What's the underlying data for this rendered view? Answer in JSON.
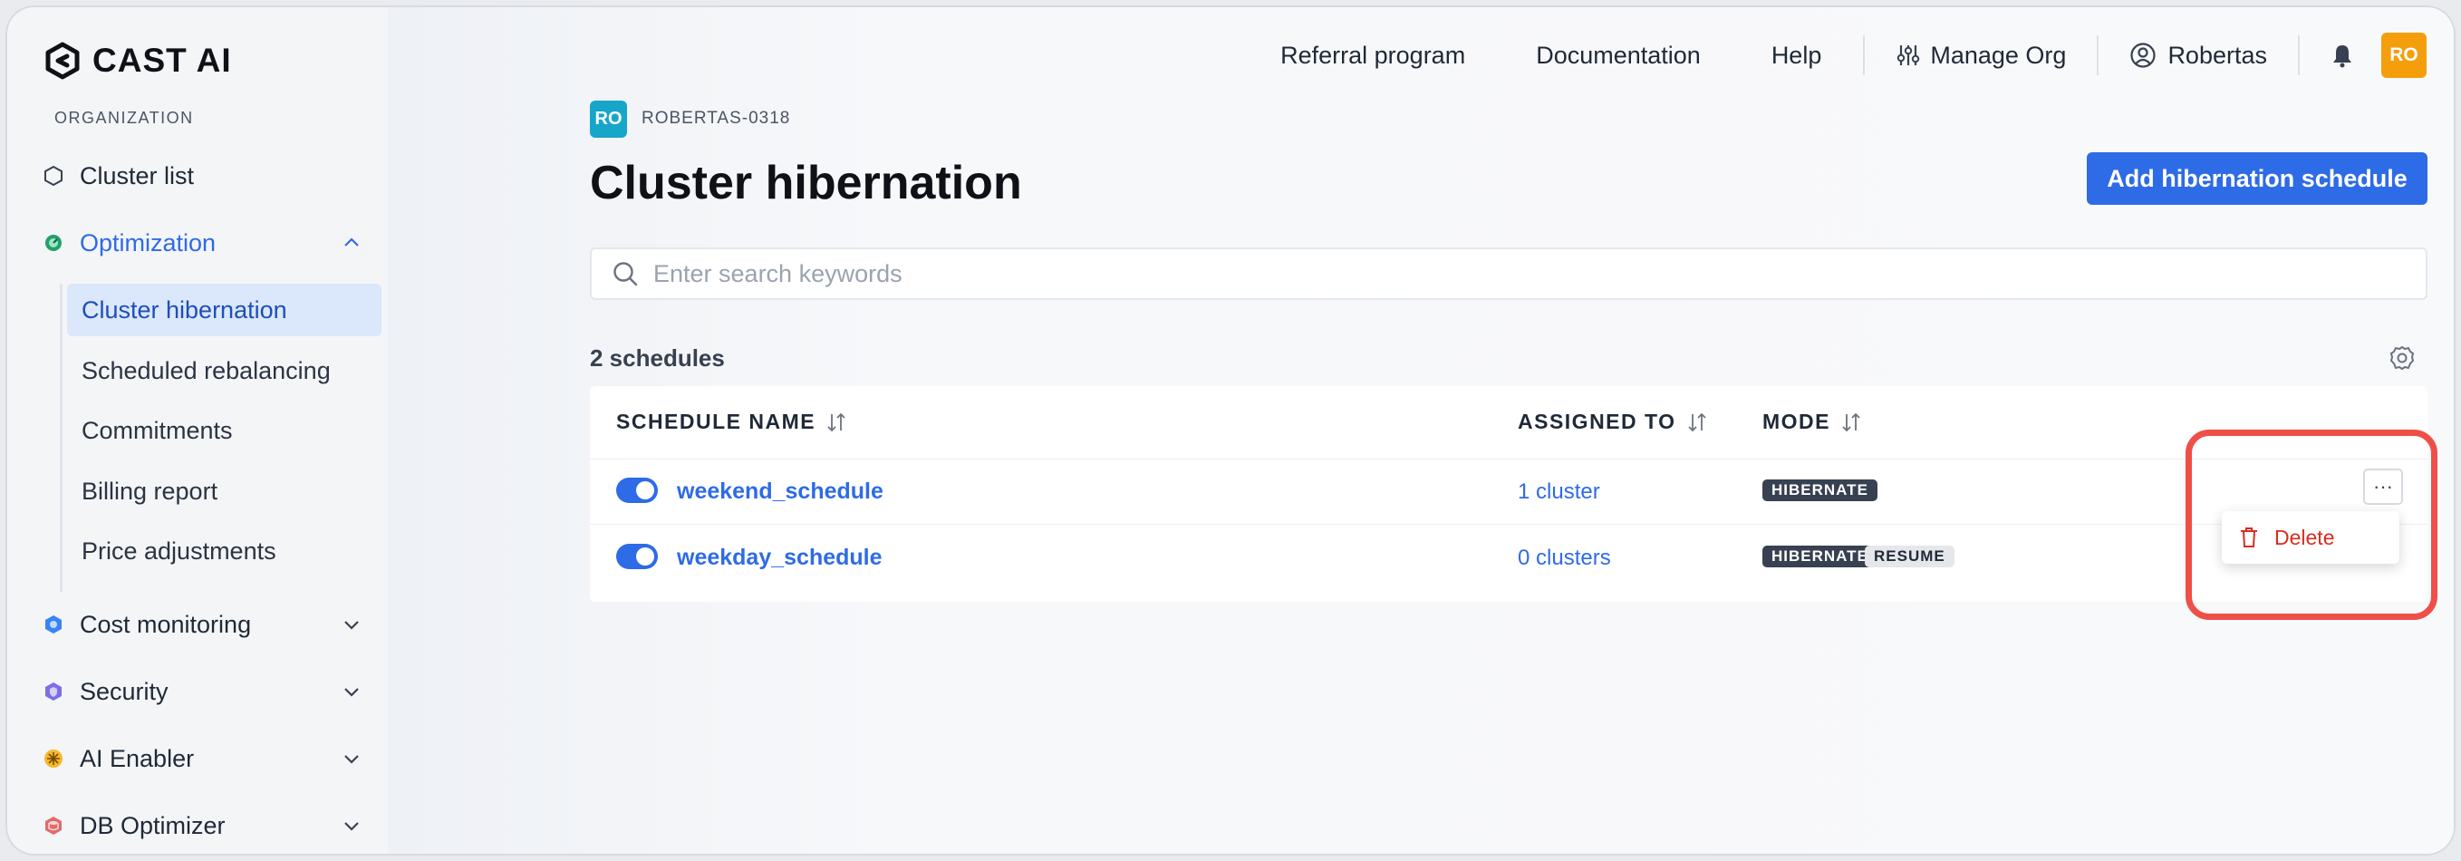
{
  "brand": {
    "name": "CAST AI"
  },
  "sidebar": {
    "section_label": "ORGANIZATION",
    "items": [
      {
        "label": "Cluster list",
        "icon": "hexagon-icon"
      },
      {
        "label": "Optimization",
        "icon": "optimization-icon",
        "expanded": true
      },
      {
        "label": "Cost monitoring",
        "icon": "cost-monitoring-icon"
      },
      {
        "label": "Security",
        "icon": "security-icon"
      },
      {
        "label": "AI Enabler",
        "icon": "ai-enabler-icon"
      },
      {
        "label": "DB Optimizer",
        "icon": "db-optimizer-icon"
      }
    ],
    "sub_items": [
      {
        "label": "Cluster hibernation",
        "selected": true
      },
      {
        "label": "Scheduled rebalancing"
      },
      {
        "label": "Commitments"
      },
      {
        "label": "Billing report"
      },
      {
        "label": "Price adjustments"
      }
    ]
  },
  "topnav": {
    "referral": "Referral program",
    "documentation": "Documentation",
    "help": "Help",
    "manage_org": "Manage Org",
    "user_name": "Robertas",
    "avatar_initials": "RO"
  },
  "org": {
    "badge": "RO",
    "code": "ROBERTAS-0318"
  },
  "page": {
    "title": "Cluster hibernation",
    "add_button": "Add hibernation schedule",
    "search_placeholder": "Enter search keywords",
    "count_label": "2 schedules"
  },
  "table": {
    "headers": {
      "name": "SCHEDULE NAME",
      "assigned": "ASSIGNED TO",
      "mode": "MODE"
    },
    "rows": [
      {
        "enabled": true,
        "name": "weekend_schedule",
        "assigned": "1 cluster",
        "modes": [
          "HIBERNATE"
        ]
      },
      {
        "enabled": true,
        "name": "weekday_schedule",
        "assigned": "0 clusters",
        "modes": [
          "HIBERNATE",
          "RESUME"
        ]
      }
    ]
  },
  "row_menu": {
    "more": "···",
    "delete": "Delete"
  },
  "colors": {
    "accent": "#2e6be6",
    "danger": "#d92d20",
    "highlight": "#ef4f47",
    "avatar": "#f59e0b",
    "org_badge": "#16a6c9"
  }
}
